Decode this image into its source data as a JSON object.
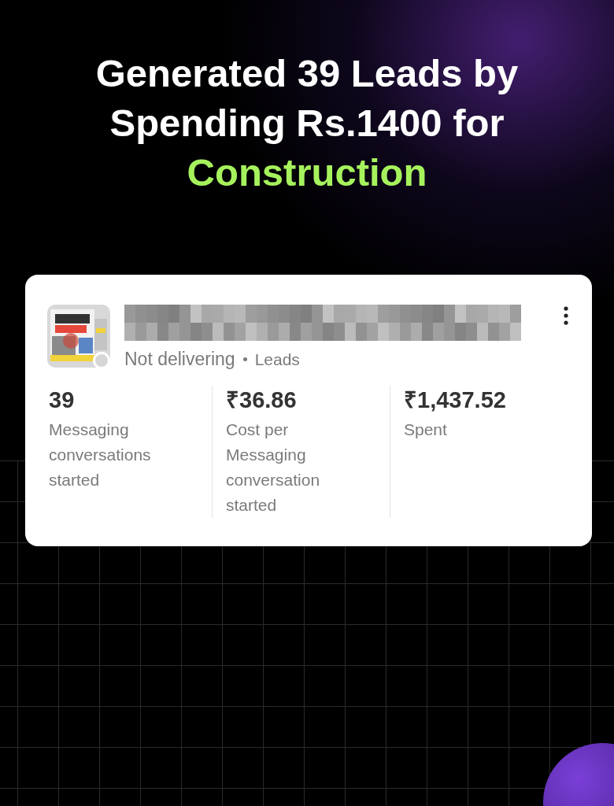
{
  "headline": {
    "text": "Generated 39 Leads by Spending Rs.1400 for",
    "highlight": "Construction"
  },
  "ad_card": {
    "delivering": false,
    "status": "Not delivering",
    "objective": "Leads",
    "metrics": [
      {
        "value": "39",
        "label": "Messaging conversations started"
      },
      {
        "value": "₹36.86",
        "label": "Cost per Messaging conversation started"
      },
      {
        "value": "₹1,437.52",
        "label": "Spent"
      }
    ]
  }
}
